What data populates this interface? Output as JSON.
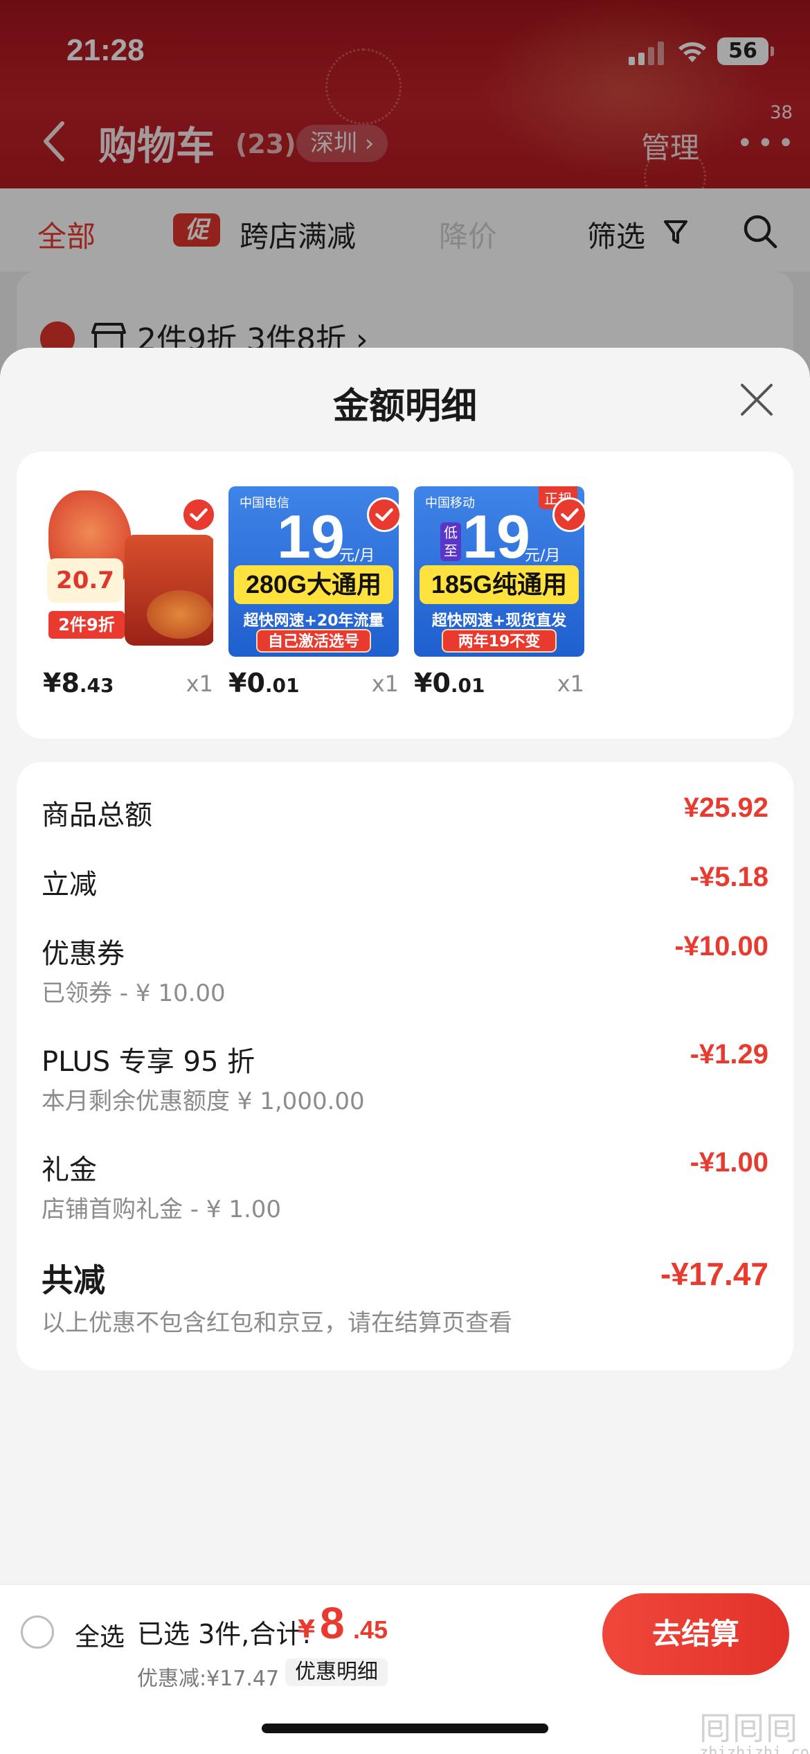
{
  "status": {
    "time": "21:28",
    "battery": "56"
  },
  "nav": {
    "title": "购物车",
    "count": "(23)",
    "location": "深圳 ›",
    "manage": "管理",
    "more": "•••",
    "badge": "38"
  },
  "filters": {
    "all": "全部",
    "promo_tag": "促",
    "cross_store": "跨店满减",
    "price_drop": "降价",
    "filter": "筛选"
  },
  "store_card": {
    "promo": "2件9折 3件8折 ›"
  },
  "sheet": {
    "title": "金额明细",
    "items": [
      {
        "price_main": "¥8",
        "price_cents": ".43",
        "qty": "x1",
        "tag1": "20.7",
        "tag2": "2件9折"
      },
      {
        "price_main": "¥0",
        "price_cents": ".01",
        "qty": "x1",
        "logo": "中国电信",
        "big": "19",
        "unit": "元/月",
        "band": "280G大通用",
        "line": "超快网速+20年流量",
        "red": "自己激活选号"
      },
      {
        "price_main": "¥0",
        "price_cents": ".01",
        "qty": "x1",
        "logo": "中国移动",
        "big": "19",
        "unit": "元/月",
        "band": "185G纯通用",
        "line": "超快网速+现货直发",
        "red": "两年19不变",
        "badge": "正规",
        "low": "低至"
      }
    ],
    "rows": [
      {
        "label": "商品总额",
        "value": "¥25.92",
        "sub": ""
      },
      {
        "label": "立减",
        "value": "-¥5.18",
        "sub": ""
      },
      {
        "label": "优惠券",
        "value": "-¥10.00",
        "sub": "已领券 - ¥ 10.00"
      },
      {
        "label": "PLUS 专享 95 折",
        "value": "-¥1.29",
        "sub": "本月剩余优惠额度  ¥ 1,000.00"
      },
      {
        "label": "礼金",
        "value": "-¥1.00",
        "sub": "店铺首购礼金 - ¥ 1.00"
      }
    ],
    "total": {
      "label": "共减",
      "value": "-¥17.47",
      "sub": "以上优惠不包含红包和京豆，请在结算页查看"
    }
  },
  "bottom": {
    "select_all": "全选",
    "selected": "已选 3件,合计:",
    "yen": "¥",
    "amount": "8",
    "cents": ".45",
    "saved": "优惠减:¥17.47",
    "detail_button": "优惠明细",
    "checkout": "去结算"
  },
  "watermark": {
    "glyphs": "囘囘囘",
    "site": "zhizhizhi.com"
  },
  "colors": {
    "accent": "#e93a2f",
    "hero": "#b51b22",
    "sheet_bg": "#f4f4f4"
  }
}
